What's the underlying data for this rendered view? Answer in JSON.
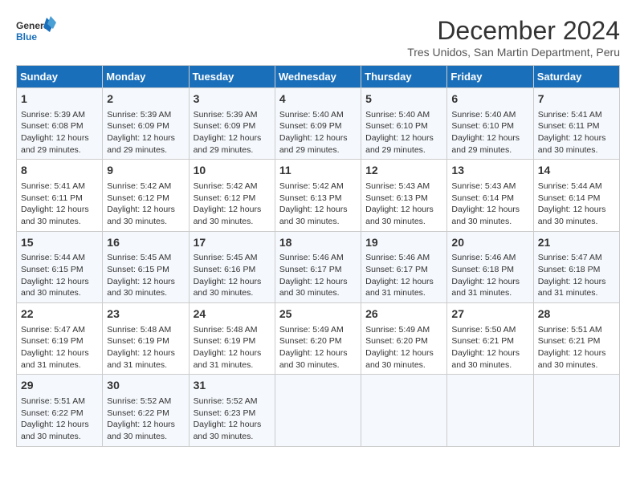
{
  "logo": {
    "line1": "General",
    "line2": "Blue"
  },
  "title": "December 2024",
  "subtitle": "Tres Unidos, San Martin Department, Peru",
  "days_of_week": [
    "Sunday",
    "Monday",
    "Tuesday",
    "Wednesday",
    "Thursday",
    "Friday",
    "Saturday"
  ],
  "weeks": [
    [
      {
        "day": "1",
        "sunrise": "5:39 AM",
        "sunset": "6:08 PM",
        "daylight": "12 hours and 29 minutes."
      },
      {
        "day": "2",
        "sunrise": "5:39 AM",
        "sunset": "6:09 PM",
        "daylight": "12 hours and 29 minutes."
      },
      {
        "day": "3",
        "sunrise": "5:39 AM",
        "sunset": "6:09 PM",
        "daylight": "12 hours and 29 minutes."
      },
      {
        "day": "4",
        "sunrise": "5:40 AM",
        "sunset": "6:09 PM",
        "daylight": "12 hours and 29 minutes."
      },
      {
        "day": "5",
        "sunrise": "5:40 AM",
        "sunset": "6:10 PM",
        "daylight": "12 hours and 29 minutes."
      },
      {
        "day": "6",
        "sunrise": "5:40 AM",
        "sunset": "6:10 PM",
        "daylight": "12 hours and 29 minutes."
      },
      {
        "day": "7",
        "sunrise": "5:41 AM",
        "sunset": "6:11 PM",
        "daylight": "12 hours and 30 minutes."
      }
    ],
    [
      {
        "day": "8",
        "sunrise": "5:41 AM",
        "sunset": "6:11 PM",
        "daylight": "12 hours and 30 minutes."
      },
      {
        "day": "9",
        "sunrise": "5:42 AM",
        "sunset": "6:12 PM",
        "daylight": "12 hours and 30 minutes."
      },
      {
        "day": "10",
        "sunrise": "5:42 AM",
        "sunset": "6:12 PM",
        "daylight": "12 hours and 30 minutes."
      },
      {
        "day": "11",
        "sunrise": "5:42 AM",
        "sunset": "6:13 PM",
        "daylight": "12 hours and 30 minutes."
      },
      {
        "day": "12",
        "sunrise": "5:43 AM",
        "sunset": "6:13 PM",
        "daylight": "12 hours and 30 minutes."
      },
      {
        "day": "13",
        "sunrise": "5:43 AM",
        "sunset": "6:14 PM",
        "daylight": "12 hours and 30 minutes."
      },
      {
        "day": "14",
        "sunrise": "5:44 AM",
        "sunset": "6:14 PM",
        "daylight": "12 hours and 30 minutes."
      }
    ],
    [
      {
        "day": "15",
        "sunrise": "5:44 AM",
        "sunset": "6:15 PM",
        "daylight": "12 hours and 30 minutes."
      },
      {
        "day": "16",
        "sunrise": "5:45 AM",
        "sunset": "6:15 PM",
        "daylight": "12 hours and 30 minutes."
      },
      {
        "day": "17",
        "sunrise": "5:45 AM",
        "sunset": "6:16 PM",
        "daylight": "12 hours and 30 minutes."
      },
      {
        "day": "18",
        "sunrise": "5:46 AM",
        "sunset": "6:17 PM",
        "daylight": "12 hours and 30 minutes."
      },
      {
        "day": "19",
        "sunrise": "5:46 AM",
        "sunset": "6:17 PM",
        "daylight": "12 hours and 31 minutes."
      },
      {
        "day": "20",
        "sunrise": "5:46 AM",
        "sunset": "6:18 PM",
        "daylight": "12 hours and 31 minutes."
      },
      {
        "day": "21",
        "sunrise": "5:47 AM",
        "sunset": "6:18 PM",
        "daylight": "12 hours and 31 minutes."
      }
    ],
    [
      {
        "day": "22",
        "sunrise": "5:47 AM",
        "sunset": "6:19 PM",
        "daylight": "12 hours and 31 minutes."
      },
      {
        "day": "23",
        "sunrise": "5:48 AM",
        "sunset": "6:19 PM",
        "daylight": "12 hours and 31 minutes."
      },
      {
        "day": "24",
        "sunrise": "5:48 AM",
        "sunset": "6:19 PM",
        "daylight": "12 hours and 31 minutes."
      },
      {
        "day": "25",
        "sunrise": "5:49 AM",
        "sunset": "6:20 PM",
        "daylight": "12 hours and 30 minutes."
      },
      {
        "day": "26",
        "sunrise": "5:49 AM",
        "sunset": "6:20 PM",
        "daylight": "12 hours and 30 minutes."
      },
      {
        "day": "27",
        "sunrise": "5:50 AM",
        "sunset": "6:21 PM",
        "daylight": "12 hours and 30 minutes."
      },
      {
        "day": "28",
        "sunrise": "5:51 AM",
        "sunset": "6:21 PM",
        "daylight": "12 hours and 30 minutes."
      }
    ],
    [
      {
        "day": "29",
        "sunrise": "5:51 AM",
        "sunset": "6:22 PM",
        "daylight": "12 hours and 30 minutes."
      },
      {
        "day": "30",
        "sunrise": "5:52 AM",
        "sunset": "6:22 PM",
        "daylight": "12 hours and 30 minutes."
      },
      {
        "day": "31",
        "sunrise": "5:52 AM",
        "sunset": "6:23 PM",
        "daylight": "12 hours and 30 minutes."
      },
      null,
      null,
      null,
      null
    ]
  ],
  "labels": {
    "sunrise_prefix": "Sunrise: ",
    "sunset_prefix": "Sunset: ",
    "daylight_prefix": "Daylight: "
  }
}
